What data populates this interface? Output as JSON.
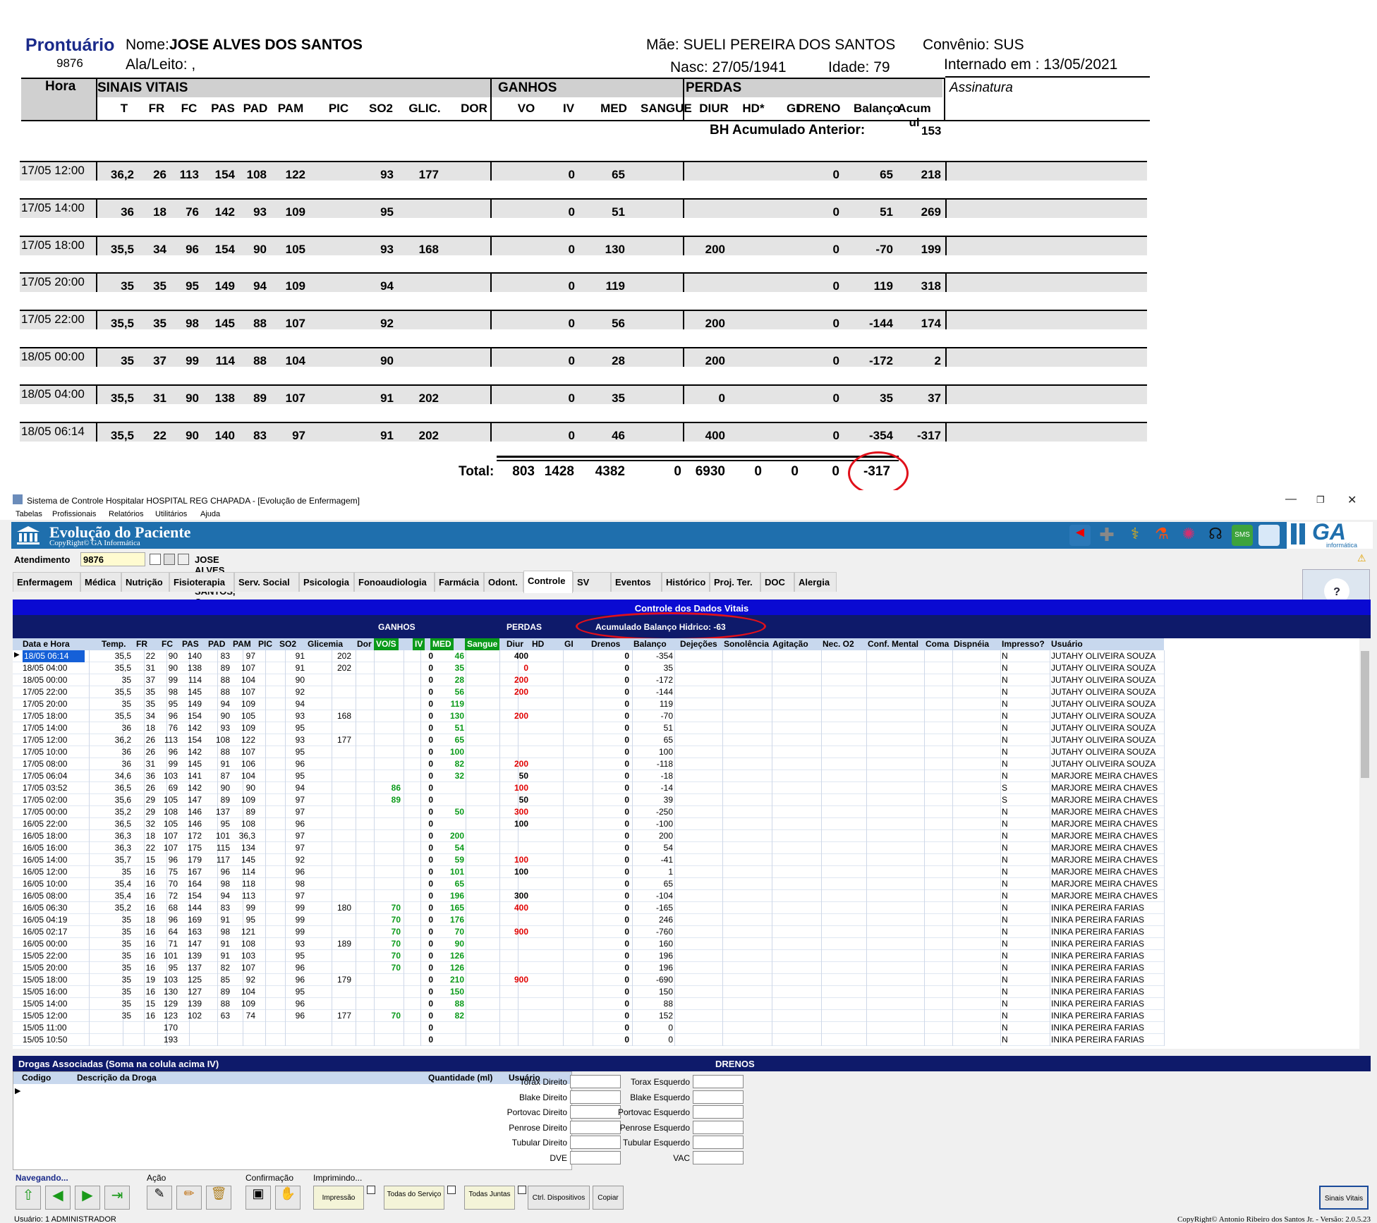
{
  "report": {
    "title": "Prontuário",
    "prontuario_num": "9876",
    "nome_label": "Nome:",
    "nome_value": "JOSE ALVES DOS SANTOS",
    "ala_label": "Ala/Leito: ,",
    "mae": "Mãe: SUELI PEREIRA DOS SANTOS",
    "convenio": "Convênio: SUS",
    "nasc": "Nasc: 27/05/1941",
    "idade": "Idade: 79",
    "internado": "Internado em : 13/05/2021",
    "hora_header": "Hora",
    "sinais_header": "SINAIS VITAIS",
    "ganhos_header": "GANHOS",
    "perdas_header": "PERDAS",
    "assinatura_header": "Assinatura",
    "cols": [
      "T",
      "FR",
      "FC",
      "PAS",
      "PAD",
      "PAM",
      "PIC",
      "SO2",
      "GLIC.",
      "DOR",
      "VO",
      "IV",
      "MED",
      "SANGUE",
      "DIUR",
      "HD*",
      "GI",
      "DRENO",
      "Balanço",
      "Acum ul"
    ],
    "bh_anterior_label": "BH Acumulado Anterior:",
    "bh_anterior_value": "153",
    "rows": [
      {
        "hora": "17/05 12:00",
        "t": "36,2",
        "fr": "26",
        "fc": "113",
        "pas": "154",
        "pad": "108",
        "pam": "122",
        "so2": "93",
        "glic": "177",
        "iv": "0",
        "med": "65",
        "diur": "",
        "dreno": "0",
        "bal": "65",
        "acum": "218"
      },
      {
        "hora": "17/05 14:00",
        "t": "36",
        "fr": "18",
        "fc": "76",
        "pas": "142",
        "pad": "93",
        "pam": "109",
        "so2": "95",
        "glic": "",
        "iv": "0",
        "med": "51",
        "diur": "",
        "dreno": "0",
        "bal": "51",
        "acum": "269"
      },
      {
        "hora": "17/05 18:00",
        "t": "35,5",
        "fr": "34",
        "fc": "96",
        "pas": "154",
        "pad": "90",
        "pam": "105",
        "so2": "93",
        "glic": "168",
        "iv": "0",
        "med": "130",
        "diur": "200",
        "dreno": "0",
        "bal": "-70",
        "acum": "199"
      },
      {
        "hora": "17/05 20:00",
        "t": "35",
        "fr": "35",
        "fc": "95",
        "pas": "149",
        "pad": "94",
        "pam": "109",
        "so2": "94",
        "glic": "",
        "iv": "0",
        "med": "119",
        "diur": "",
        "dreno": "0",
        "bal": "119",
        "acum": "318"
      },
      {
        "hora": "17/05 22:00",
        "t": "35,5",
        "fr": "35",
        "fc": "98",
        "pas": "145",
        "pad": "88",
        "pam": "107",
        "so2": "92",
        "glic": "",
        "iv": "0",
        "med": "56",
        "diur": "200",
        "dreno": "0",
        "bal": "-144",
        "acum": "174"
      },
      {
        "hora": "18/05 00:00",
        "t": "35",
        "fr": "37",
        "fc": "99",
        "pas": "114",
        "pad": "88",
        "pam": "104",
        "so2": "90",
        "glic": "",
        "iv": "0",
        "med": "28",
        "diur": "200",
        "dreno": "0",
        "bal": "-172",
        "acum": "2"
      },
      {
        "hora": "18/05 04:00",
        "t": "35,5",
        "fr": "31",
        "fc": "90",
        "pas": "138",
        "pad": "89",
        "pam": "107",
        "so2": "91",
        "glic": "202",
        "iv": "0",
        "med": "35",
        "diur": "0",
        "dreno": "0",
        "bal": "35",
        "acum": "37"
      },
      {
        "hora": "18/05 06:14",
        "t": "35,5",
        "fr": "22",
        "fc": "90",
        "pas": "140",
        "pad": "83",
        "pam": "97",
        "so2": "91",
        "glic": "202",
        "iv": "0",
        "med": "46",
        "diur": "400",
        "dreno": "0",
        "bal": "-354",
        "acum": "-317"
      }
    ],
    "total_label": "Total:",
    "totals": [
      "803",
      "1428",
      "4382",
      "0",
      "6930",
      "0",
      "0",
      "0",
      "-317"
    ]
  },
  "app": {
    "window_title": "Sistema de Controle Hospitalar HOSPITAL REG CHAPADA - [Evolução de Enfermagem]",
    "menu": [
      "Tabelas",
      "Profissionais",
      "Relatórios",
      "Utilitários",
      "Ajuda"
    ],
    "banner_title": "Evolução do Paciente",
    "banner_sub": "CopyRight© GA Informática",
    "logo_text": "GA",
    "logo_sub": "informática",
    "atendimento_label": "Atendimento",
    "atendimento_value": "9876",
    "patient_line": "JOSE ALVES DOS SANTOS, Conv.: SUS",
    "tabs": [
      "Enfermagem",
      "Médica",
      "Nutrição",
      "Fisioterapia",
      "Serv. Social",
      "Psicologia",
      "Fonoaudiologia",
      "Farmácia",
      "Odont.",
      "Controle",
      "SV",
      "Eventos",
      "Histórico",
      "Proj. Ter.",
      "DOC",
      "Alergia"
    ],
    "active_tab": "Controle",
    "controle_title": "Controle dos Dados Vitais",
    "ganhos": "GANHOS",
    "perdas": "PERDAS",
    "acumulado": "Acumulado Balanço Hidrico: -63",
    "grid_headers": [
      "Data e Hora",
      "Temp.",
      "FR",
      "FC",
      "PAS",
      "PAD",
      "PAM",
      "PIC",
      "SO2",
      "Glicemia",
      "Dor",
      "VO/S",
      "IV",
      "MED",
      "Sangue",
      "Diur",
      "HD",
      "GI",
      "Drenos",
      "Balanço",
      "Dejeções",
      "Sonolência",
      "Agitação",
      "Nec. O2",
      "Conf. Mental",
      "Coma",
      "Dispnéia",
      "Impresso?",
      "Usuário"
    ],
    "grid_rows": [
      [
        "18/05 06:14",
        "35,5",
        "22",
        "90",
        "140",
        "83",
        "97",
        "",
        "91",
        "202",
        "",
        "",
        "0",
        "46",
        "",
        "400",
        "",
        "",
        "0",
        "-354",
        "N",
        "JUTAHY OLIVEIRA SOUZA"
      ],
      [
        "18/05 04:00",
        "35,5",
        "31",
        "90",
        "138",
        "89",
        "107",
        "",
        "91",
        "202",
        "",
        "",
        "0",
        "35",
        "",
        "0",
        "",
        "",
        "0",
        "35",
        "N",
        "JUTAHY OLIVEIRA SOUZA"
      ],
      [
        "18/05 00:00",
        "35",
        "37",
        "99",
        "114",
        "88",
        "104",
        "",
        "90",
        "",
        "",
        "",
        "0",
        "28",
        "",
        "200",
        "",
        "",
        "0",
        "-172",
        "N",
        "JUTAHY OLIVEIRA SOUZA"
      ],
      [
        "17/05 22:00",
        "35,5",
        "35",
        "98",
        "145",
        "88",
        "107",
        "",
        "92",
        "",
        "",
        "",
        "0",
        "56",
        "",
        "200",
        "",
        "",
        "0",
        "-144",
        "N",
        "JUTAHY OLIVEIRA SOUZA"
      ],
      [
        "17/05 20:00",
        "35",
        "35",
        "95",
        "149",
        "94",
        "109",
        "",
        "94",
        "",
        "",
        "",
        "0",
        "119",
        "",
        "",
        "",
        "",
        "0",
        "119",
        "N",
        "JUTAHY OLIVEIRA SOUZA"
      ],
      [
        "17/05 18:00",
        "35,5",
        "34",
        "96",
        "154",
        "90",
        "105",
        "",
        "93",
        "168",
        "",
        "",
        "0",
        "130",
        "",
        "200",
        "",
        "",
        "0",
        "-70",
        "N",
        "JUTAHY OLIVEIRA SOUZA"
      ],
      [
        "17/05 14:00",
        "36",
        "18",
        "76",
        "142",
        "93",
        "109",
        "",
        "95",
        "",
        "",
        "",
        "0",
        "51",
        "",
        "",
        "",
        "",
        "0",
        "51",
        "N",
        "JUTAHY OLIVEIRA SOUZA"
      ],
      [
        "17/05 12:00",
        "36,2",
        "26",
        "113",
        "154",
        "108",
        "122",
        "",
        "93",
        "177",
        "",
        "",
        "0",
        "65",
        "",
        "",
        "",
        "",
        "0",
        "65",
        "N",
        "JUTAHY OLIVEIRA SOUZA"
      ],
      [
        "17/05 10:00",
        "36",
        "26",
        "96",
        "142",
        "88",
        "107",
        "",
        "95",
        "",
        "",
        "",
        "0",
        "100",
        "",
        "",
        "",
        "",
        "0",
        "100",
        "N",
        "JUTAHY OLIVEIRA SOUZA"
      ],
      [
        "17/05 08:00",
        "36",
        "31",
        "99",
        "145",
        "91",
        "106",
        "",
        "96",
        "",
        "",
        "",
        "0",
        "82",
        "",
        "200",
        "",
        "",
        "0",
        "-118",
        "N",
        "JUTAHY OLIVEIRA SOUZA"
      ],
      [
        "17/05 06:04",
        "34,6",
        "36",
        "103",
        "141",
        "87",
        "104",
        "",
        "95",
        "",
        "",
        "",
        "0",
        "32",
        "",
        "50",
        "",
        "",
        "0",
        "-18",
        "N",
        "MARJORE MEIRA CHAVES"
      ],
      [
        "17/05 03:52",
        "36,5",
        "26",
        "69",
        "142",
        "90",
        "90",
        "",
        "94",
        "",
        "",
        "86",
        "0",
        "",
        "",
        "100",
        "",
        "",
        "0",
        "-14",
        "S",
        "MARJORE MEIRA CHAVES"
      ],
      [
        "17/05 02:00",
        "35,6",
        "29",
        "105",
        "147",
        "89",
        "109",
        "",
        "97",
        "",
        "",
        "89",
        "0",
        "",
        "",
        "50",
        "",
        "",
        "0",
        "39",
        "S",
        "MARJORE MEIRA CHAVES"
      ],
      [
        "17/05 00:00",
        "35,2",
        "29",
        "108",
        "146",
        "137",
        "89",
        "",
        "97",
        "",
        "",
        "",
        "0",
        "50",
        "",
        "300",
        "",
        "",
        "0",
        "-250",
        "N",
        "MARJORE MEIRA CHAVES"
      ],
      [
        "16/05 22:00",
        "36,5",
        "32",
        "105",
        "146",
        "95",
        "108",
        "",
        "96",
        "",
        "",
        "",
        "0",
        "",
        "",
        "100",
        "",
        "",
        "0",
        "-100",
        "N",
        "MARJORE MEIRA CHAVES"
      ],
      [
        "16/05 18:00",
        "36,3",
        "18",
        "107",
        "172",
        "101",
        "36,3",
        "",
        "97",
        "",
        "",
        "",
        "0",
        "200",
        "",
        "",
        "",
        "",
        "0",
        "200",
        "N",
        "MARJORE MEIRA CHAVES"
      ],
      [
        "16/05 16:00",
        "36,3",
        "22",
        "107",
        "175",
        "115",
        "134",
        "",
        "97",
        "",
        "",
        "",
        "0",
        "54",
        "",
        "",
        "",
        "",
        "0",
        "54",
        "N",
        "MARJORE MEIRA CHAVES"
      ],
      [
        "16/05 14:00",
        "35,7",
        "15",
        "96",
        "179",
        "117",
        "145",
        "",
        "92",
        "",
        "",
        "",
        "0",
        "59",
        "",
        "100",
        "",
        "",
        "0",
        "-41",
        "N",
        "MARJORE MEIRA CHAVES"
      ],
      [
        "16/05 12:00",
        "35",
        "16",
        "75",
        "167",
        "96",
        "114",
        "",
        "96",
        "",
        "",
        "",
        "0",
        "101",
        "",
        "100",
        "",
        "",
        "0",
        "1",
        "N",
        "MARJORE MEIRA CHAVES"
      ],
      [
        "16/05 10:00",
        "35,4",
        "16",
        "70",
        "164",
        "98",
        "118",
        "",
        "98",
        "",
        "",
        "",
        "0",
        "65",
        "",
        "",
        "",
        "",
        "0",
        "65",
        "N",
        "MARJORE MEIRA CHAVES"
      ],
      [
        "16/05 08:00",
        "35,4",
        "16",
        "72",
        "154",
        "94",
        "113",
        "",
        "97",
        "",
        "",
        "",
        "0",
        "196",
        "",
        "300",
        "",
        "",
        "0",
        "-104",
        "N",
        "MARJORE MEIRA CHAVES"
      ],
      [
        "16/05 06:30",
        "35,2",
        "16",
        "68",
        "144",
        "83",
        "99",
        "",
        "99",
        "180",
        "",
        "70",
        "0",
        "165",
        "",
        "400",
        "",
        "",
        "0",
        "-165",
        "N",
        "INIKA PEREIRA FARIAS"
      ],
      [
        "16/05 04:19",
        "35",
        "18",
        "96",
        "169",
        "91",
        "95",
        "",
        "99",
        "",
        "",
        "70",
        "0",
        "176",
        "",
        "",
        "",
        "",
        "0",
        "246",
        "N",
        "INIKA PEREIRA FARIAS"
      ],
      [
        "16/05 02:17",
        "35",
        "16",
        "64",
        "163",
        "98",
        "121",
        "",
        "99",
        "",
        "",
        "70",
        "0",
        "70",
        "",
        "900",
        "",
        "",
        "0",
        "-760",
        "N",
        "INIKA PEREIRA FARIAS"
      ],
      [
        "16/05 00:00",
        "35",
        "16",
        "71",
        "147",
        "91",
        "108",
        "",
        "93",
        "189",
        "",
        "70",
        "0",
        "90",
        "",
        "",
        "",
        "",
        "0",
        "160",
        "N",
        "INIKA PEREIRA FARIAS"
      ],
      [
        "15/05 22:00",
        "35",
        "16",
        "101",
        "139",
        "91",
        "103",
        "",
        "95",
        "",
        "",
        "70",
        "0",
        "126",
        "",
        "",
        "",
        "",
        "0",
        "196",
        "N",
        "INIKA PEREIRA FARIAS"
      ],
      [
        "15/05 20:00",
        "35",
        "16",
        "95",
        "137",
        "82",
        "107",
        "",
        "96",
        "",
        "",
        "70",
        "0",
        "126",
        "",
        "",
        "",
        "",
        "0",
        "196",
        "N",
        "INIKA PEREIRA FARIAS"
      ],
      [
        "15/05 18:00",
        "35",
        "19",
        "103",
        "125",
        "85",
        "92",
        "",
        "96",
        "179",
        "",
        "",
        "0",
        "210",
        "",
        "900",
        "",
        "",
        "0",
        "-690",
        "N",
        "INIKA PEREIRA FARIAS"
      ],
      [
        "15/05 16:00",
        "35",
        "16",
        "130",
        "127",
        "89",
        "104",
        "",
        "95",
        "",
        "",
        "",
        "0",
        "150",
        "",
        "",
        "",
        "",
        "0",
        "150",
        "N",
        "INIKA PEREIRA FARIAS"
      ],
      [
        "15/05 14:00",
        "35",
        "15",
        "129",
        "139",
        "88",
        "109",
        "",
        "96",
        "",
        "",
        "",
        "0",
        "88",
        "",
        "",
        "",
        "",
        "0",
        "88",
        "N",
        "INIKA PEREIRA FARIAS"
      ],
      [
        "15/05 12:00",
        "35",
        "16",
        "123",
        "102",
        "63",
        "74",
        "",
        "96",
        "177",
        "",
        "70",
        "0",
        "82",
        "",
        "",
        "",
        "",
        "0",
        "152",
        "N",
        "INIKA PEREIRA FARIAS"
      ],
      [
        "15/05 11:00",
        "",
        "",
        "170",
        "",
        "",
        "",
        "",
        "",
        "",
        "",
        "",
        "0",
        "",
        "",
        "",
        "",
        "",
        "0",
        "0",
        "N",
        "INIKA PEREIRA FARIAS"
      ],
      [
        "15/05 10:50",
        "",
        "",
        "193",
        "",
        "",
        "",
        "",
        "",
        "",
        "",
        "",
        "0",
        "",
        "",
        "",
        "",
        "",
        "0",
        "0",
        "N",
        "INIKA PEREIRA FARIAS"
      ]
    ],
    "drogas_title": "Drogas Associadas (Soma na colula acima IV)",
    "drogas_headers": [
      "Codigo",
      "Descrição da Droga",
      "Quantidade (ml)",
      "Usuário"
    ],
    "drenos_title": "DRENOS",
    "drenos_left": [
      "Torax Direito",
      "Blake Direito",
      "Portovac Direito",
      "Penrose Direito",
      "Tubular Direito",
      "DVE"
    ],
    "drenos_right": [
      "Torax Esquerdo",
      "Blake Esquerdo",
      "Portovac Esquerdo",
      "Penrose Esquerdo",
      "Tubular Esquerdo",
      "VAC"
    ],
    "grp_navegando": "Navegando...",
    "grp_acao": "Ação",
    "grp_confirmacao": "Confirmação",
    "grp_imprimindo": "Imprimindo...",
    "btn_impressao": "Impressão",
    "btn_todas_servico": "Todas do Serviço",
    "btn_todas_juntas": "Todas Juntas",
    "btn_ctrl": "Ctrl. Dispositivos",
    "btn_copiar": "Copiar",
    "btn_sinais": "Sinais Vitais",
    "status_user": "Usuário:  1   ADMINISTRADOR",
    "status_copy": "CopyRight© Antonio Ribeiro dos Santos Jr. - Versão: 2.0.5.23"
  }
}
